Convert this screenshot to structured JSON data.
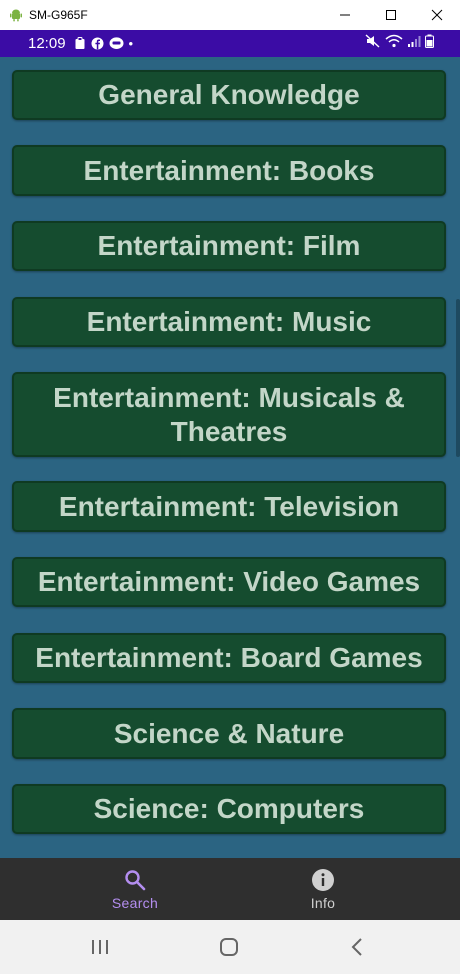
{
  "window": {
    "title": "SM-G965F"
  },
  "statusbar": {
    "time": "12:09",
    "dot": "•"
  },
  "categories": [
    "General Knowledge",
    "Entertainment: Books",
    "Entertainment: Film",
    "Entertainment: Music",
    "Entertainment: Musicals & Theatres",
    "Entertainment: Television",
    "Entertainment: Video Games",
    "Entertainment: Board Games",
    "Science & Nature",
    "Science: Computers"
  ],
  "bottom_nav": {
    "search_label": "Search",
    "info_label": "Info",
    "active": "search"
  },
  "colors": {
    "status_bar": "#3b0ca5",
    "content_bg": "#2b6482",
    "button_bg": "#154c2f",
    "button_text": "#c3d6c8",
    "nav_bg": "#2f2f2f",
    "nav_active": "#b48ef0",
    "nav_inactive": "#d0d0d0"
  }
}
